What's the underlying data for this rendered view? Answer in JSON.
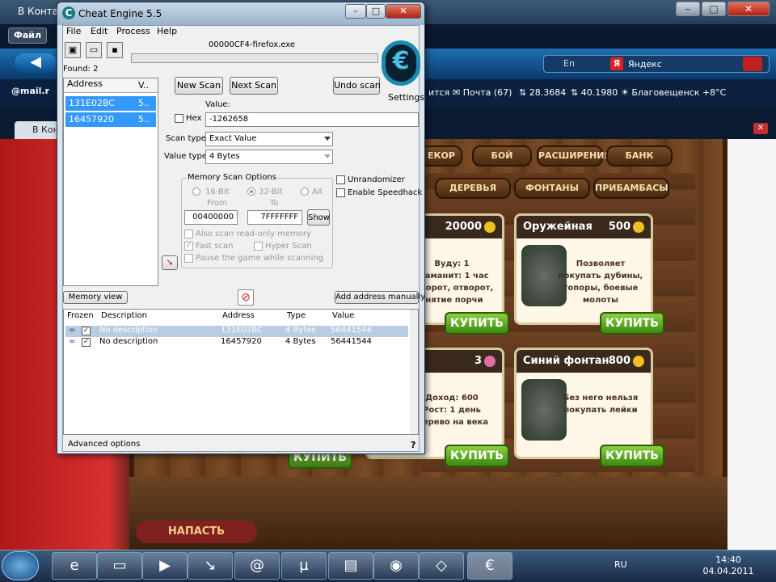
{
  "firefox": {
    "title": "В Конта",
    "menu_button": "Файл",
    "search_engine": "Яндекс",
    "search_lang": "En",
    "mail_label": "@mail.r",
    "bookmarks": [
      "ится",
      "Почта (67)",
      "28.3684",
      "40.1980",
      "Благовещенск +8°C"
    ],
    "tab_label": "В Кон"
  },
  "game": {
    "tabs": [
      "ЕКОР",
      "БОЙ",
      "РАСШИРЕНИЯ",
      "БАНК",
      "ДЕРЕВЬЯ",
      "ФОНТАНЫ",
      "ПРИБАМБАСЫ"
    ],
    "cards": [
      {
        "title": "",
        "price": "20000",
        "desc": "Вуду: 1\nШаманит: 1 час\nотворот, отворот,\nснятие порчи",
        "buy": "КУПИТЬ"
      },
      {
        "title": "Оружейная",
        "price": "500",
        "desc": "Позволяет покупать дубины, топоры, боевые молоты",
        "buy": "КУПИТЬ"
      },
      {
        "title": "",
        "price": "3",
        "desc": "Доход: 600\nРост: 1 день\nДерево на века",
        "buy": "КУПИТЬ"
      },
      {
        "title": "Синий фонтан",
        "price": "800",
        "desc": "Без него нельзя покупать лейки",
        "buy": "КУПИТЬ"
      }
    ],
    "attack": "НАПАСТЬ",
    "bottom_buy": "КУПИТЬ"
  },
  "cheat_engine": {
    "title": "Cheat Engine 5.5",
    "menu": [
      "File",
      "Edit",
      "Process",
      "Help"
    ],
    "process": "00000CF4-firefox.exe",
    "found": "Found: 2",
    "address_header": "Address",
    "value_header": "V..",
    "addresses": [
      {
        "addr": "131E02BC",
        "val": "5.."
      },
      {
        "addr": "16457920",
        "val": "5.."
      }
    ],
    "new_scan": "New Scan",
    "next_scan": "Next Scan",
    "undo_scan": "Undo scan",
    "settings": "Settings",
    "value_label": "Value:",
    "hex_label": "Hex",
    "value": "-1262658",
    "scan_type_label": "Scan type",
    "scan_type": "Exact Value",
    "value_type_label": "Value type",
    "value_type": "4 Bytes",
    "memory_options": "Memory Scan Options",
    "bit16": "16-Bit",
    "bit32": "32-Bit",
    "all": "All",
    "from_label": "From",
    "to_label": "To",
    "from_value": "00400000",
    "to_value": "7FFFFFFF",
    "show": "Show",
    "readonly": "Also scan read-only memory",
    "fast_scan": "Fast scan",
    "hyper_scan": "Hyper Scan",
    "pause_game": "Pause the game while scanning",
    "unrandomizer": "Unrandomizer",
    "speedhack": "Enable Speedhack",
    "memory_view": "Memory view",
    "add_manually": "Add address manually",
    "result_headers": [
      "Frozen",
      "Description",
      "Address",
      "Type",
      "Value"
    ],
    "results": [
      {
        "frozen": "=",
        "desc": "No description",
        "addr": "131E02BC",
        "type": "4 Bytes",
        "value": "56441544"
      },
      {
        "frozen": "=",
        "desc": "No description",
        "addr": "16457920",
        "type": "4 Bytes",
        "value": "56441544"
      }
    ],
    "advanced": "Advanced options",
    "help": "?"
  },
  "taskbar": {
    "lang": "RU",
    "time": "14:40",
    "date": "04.04.2011"
  }
}
